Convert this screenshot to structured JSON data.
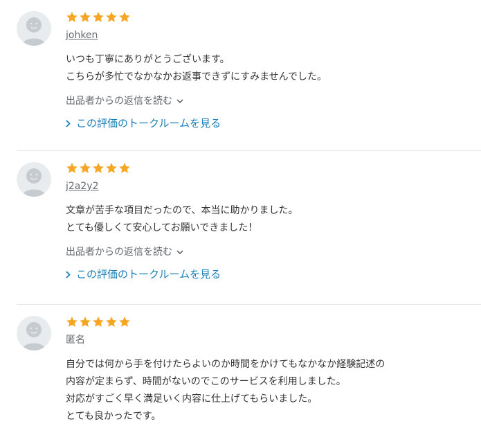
{
  "colors": {
    "star": "#f6a623",
    "link": "#1a7fb8",
    "muted": "#666a6e",
    "text": "#333333"
  },
  "reviews": [
    {
      "rating": 5,
      "user": "johken",
      "lines": [
        "いつも丁寧にありがとうございます。",
        "こちらが多忙でなかなかお返事できずにすみませんでした。"
      ],
      "reply_label": "出品者からの返信を読む",
      "talk_label": "この評価のトークルームを見る"
    },
    {
      "rating": 5,
      "user": "j2a2y2",
      "lines": [
        "文章が苦手な項目だったので、本当に助かりました。",
        "とても優しくて安心してお願いできました！"
      ],
      "reply_label": "出品者からの返信を読む",
      "talk_label": "この評価のトークルームを見る"
    },
    {
      "rating": 5,
      "user": "匿名",
      "lines": [
        "自分では何から手を付けたらよいのか時間をかけてもなかなか経験記述の",
        "内容が定まらず、時間がないのでこのサービスを利用しました。",
        "対応がすごく早く満足いく内容に仕上げてもらいました。",
        "とても良かったです。"
      ]
    }
  ]
}
